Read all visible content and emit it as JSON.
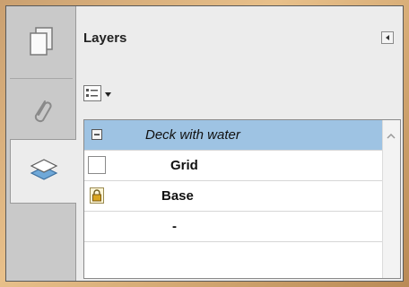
{
  "panel": {
    "title": "Layers"
  },
  "rail": {
    "tabs": [
      {
        "name": "pages",
        "icon": "pages-icon",
        "active": false
      },
      {
        "name": "attachments",
        "icon": "paperclip-icon",
        "active": false
      },
      {
        "name": "layers",
        "icon": "layers-icon",
        "active": true
      }
    ]
  },
  "layers": [
    {
      "label": "Deck with water",
      "control": "collapse-minus",
      "style": "italic",
      "selected": true
    },
    {
      "label": "Grid",
      "control": "visibility-checkbox",
      "style": "bold",
      "selected": false
    },
    {
      "label": "Base",
      "control": "lock",
      "style": "bold",
      "selected": false
    },
    {
      "label": "-",
      "control": "none",
      "style": "bold",
      "selected": false
    }
  ],
  "colors": {
    "selection": "#9ec3e3",
    "panel_bg": "#ececec",
    "rail_bg": "#c9c9c9"
  }
}
